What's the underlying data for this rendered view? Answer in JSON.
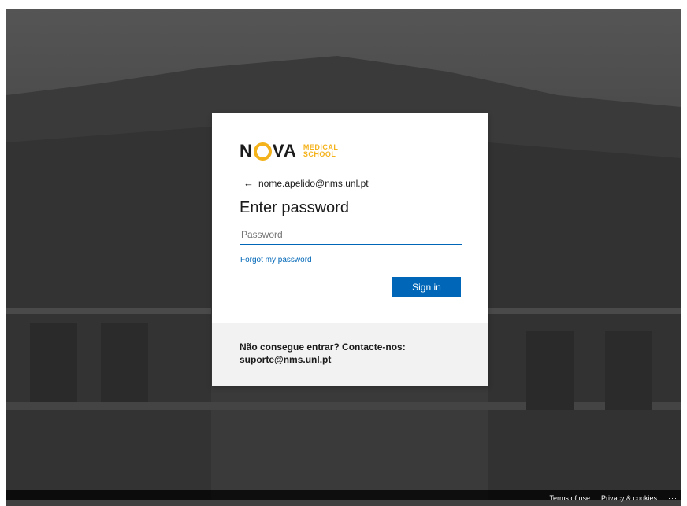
{
  "logo": {
    "brand": "N VA",
    "sub_line1": "MEDICAL",
    "sub_line2": "SCHOOL"
  },
  "identity": {
    "back_icon": "←",
    "email": "nome.apelido@nms.unl.pt"
  },
  "title": "Enter password",
  "password": {
    "placeholder": "Password",
    "value": ""
  },
  "forgot_link": "Forgot my password",
  "signin_label": "Sign in",
  "help": {
    "line1": "Não consegue entrar? Contacte-nos:",
    "line2": "suporte@nms.unl.pt"
  },
  "footer": {
    "terms": "Terms of use",
    "privacy": "Privacy & cookies",
    "more": "···"
  },
  "colors": {
    "accent": "#0067b8",
    "brand_yellow": "#f4b21b",
    "help_bg": "#f2f2f2"
  }
}
